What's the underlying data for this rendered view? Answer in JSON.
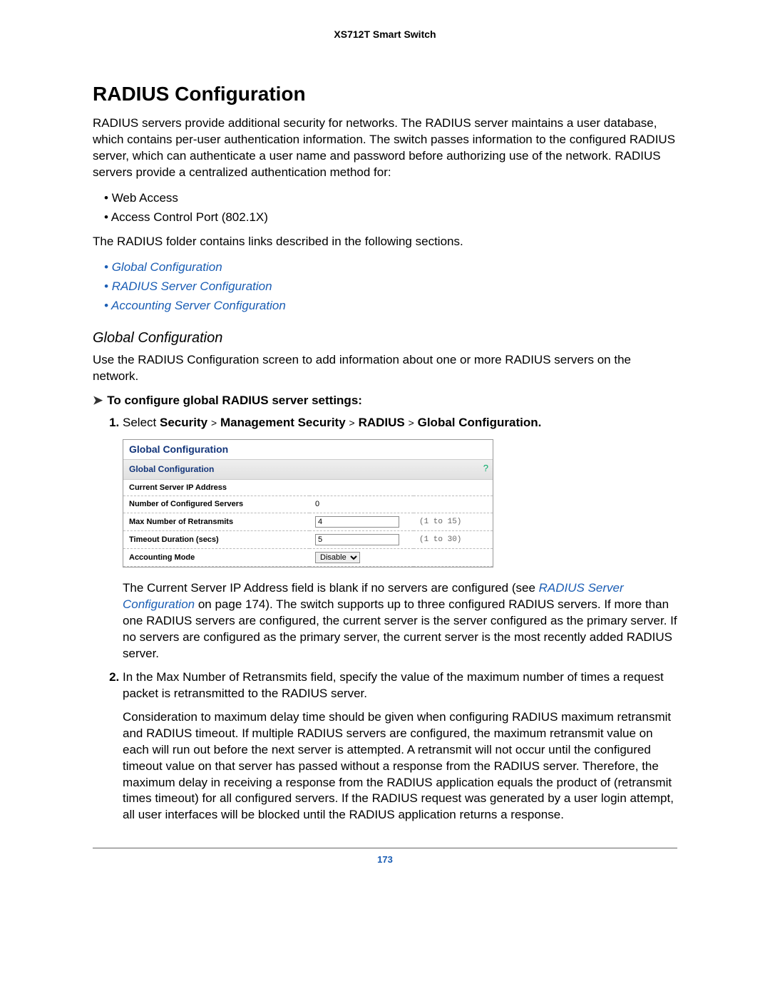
{
  "header": {
    "product": "XS712T Smart Switch"
  },
  "h1": "RADIUS Configuration",
  "intro": "RADIUS servers provide additional security for networks. The RADIUS server maintains a user database, which contains per-user authentication information. The switch passes information to the configured RADIUS server, which can authenticate a user name and password before authorizing use of the network. RADIUS servers provide a centralized authentication method for:",
  "intro_bullets": [
    "Web Access",
    "Access Control Port (802.1X)"
  ],
  "folder_line": "The RADIUS folder contains links described in the following sections.",
  "link_bullets": [
    "Global Configuration",
    "RADIUS Server Configuration",
    "Accounting Server Configuration"
  ],
  "h2": "Global Configuration",
  "gc_intro": "Use the RADIUS Configuration screen to add information about one or more RADIUS servers on the network.",
  "arrow_line": "To configure global RADIUS server settings:",
  "step1": {
    "prefix": "Select ",
    "crumbs": [
      "Security",
      "Management Security",
      "RADIUS",
      "Global Configuration."
    ],
    "sep": ">"
  },
  "figure": {
    "title": "Global Configuration",
    "subtitle": "Global Configuration",
    "help_icon": "?",
    "rows": [
      {
        "label": "Current Server IP Address",
        "value": "",
        "range": "",
        "type": "text-readonly"
      },
      {
        "label": "Number of Configured Servers",
        "value": "0",
        "range": "",
        "type": "text-readonly"
      },
      {
        "label": "Max Number of Retransmits",
        "value": "4",
        "range": "(1 to 15)",
        "type": "input"
      },
      {
        "label": "Timeout Duration (secs)",
        "value": "5",
        "range": "(1 to 30)",
        "type": "input"
      },
      {
        "label": "Accounting Mode",
        "value": "Disable",
        "range": "",
        "type": "select"
      }
    ]
  },
  "step1_after": {
    "t1": "The Current Server IP Address field is blank if no servers are configured (see ",
    "link": "RADIUS Server Configuration",
    "t2": " on page 174). The switch supports up to three configured RADIUS servers. If more than one RADIUS servers are configured, the current server is the server configured as the primary server. If no servers are configured as the primary server, the current server is the most recently added RADIUS server."
  },
  "step2": "In the Max Number of Retransmits field, specify the value of the maximum number of times a request packet is retransmitted to the RADIUS server.",
  "step2_after": "Consideration to maximum delay time should be given when configuring RADIUS maximum retransmit and RADIUS timeout. If multiple RADIUS servers are configured, the maximum retransmit value on each will run out before the next server is attempted. A retransmit will not occur until the configured timeout value on that server has passed without a response from the RADIUS server. Therefore, the maximum delay in receiving a response from the RADIUS application equals the product of (retransmit times timeout) for all configured servers. If the RADIUS request was generated by a user login attempt, all user interfaces will be blocked until the RADIUS application returns a response.",
  "page_number": "173"
}
